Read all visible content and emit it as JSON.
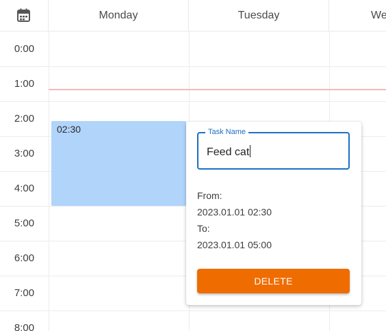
{
  "header": {
    "calendar_icon": "calendar-icon",
    "days": [
      "Monday",
      "Tuesday",
      "Wednesday"
    ]
  },
  "times": [
    "0:00",
    "1:00",
    "2:00",
    "3:00",
    "4:00",
    "5:00",
    "6:00",
    "7:00",
    "8:00"
  ],
  "event": {
    "start_label": "02:30",
    "color": "#b1d4fa"
  },
  "popup": {
    "task_name_label": "Task Name",
    "task_name_value": "Feed cat",
    "from_label": "From:",
    "from_value": "2023.01.01 02:30",
    "to_label": "To:",
    "to_value": "2023.01.01 05:00",
    "delete_label": "DELETE",
    "accent_color": "#1a6fc4",
    "delete_color": "#ef6c00"
  },
  "now_indicator_color": "#f6b8b8"
}
